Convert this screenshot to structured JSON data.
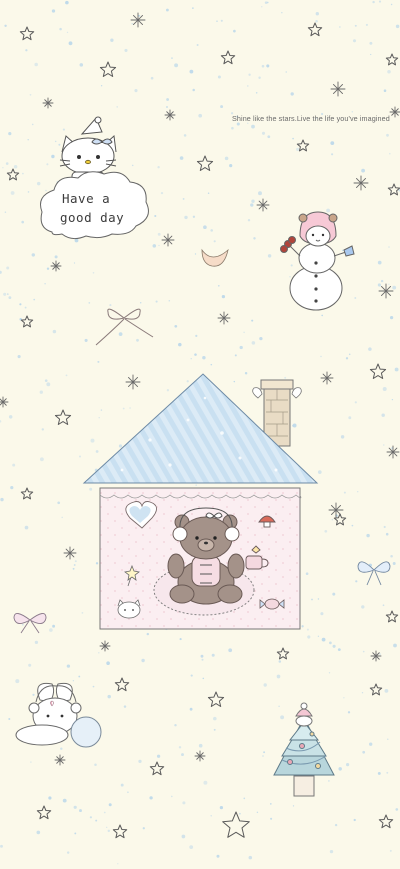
{
  "wallpaper": {
    "tagline": "Shine like the stars.Live the life you've imagined",
    "cloud_message_line1": "Have a",
    "cloud_message_line2": "good day",
    "colors": {
      "background": "#fbf9ea",
      "sky_dots": "#bcd8ea",
      "roof": "#c6def0",
      "house_wall": "#fbeef0",
      "snowman_hood": "#f7c9d6",
      "bear": "#a08c82",
      "line": "#555555"
    },
    "icons": [
      "hello-kitty-icon",
      "cloud-icon",
      "crescent-moon-icon",
      "snowman-icon",
      "ribbon-bow-icon",
      "house-icon",
      "chimney-icon",
      "teddy-bear-icon",
      "heart-icon",
      "mushroom-icon",
      "cup-icon",
      "candy-icon",
      "bunny-icon",
      "snowball-icon",
      "christmas-tree-icon",
      "star-icon",
      "sparkle-icon"
    ]
  }
}
